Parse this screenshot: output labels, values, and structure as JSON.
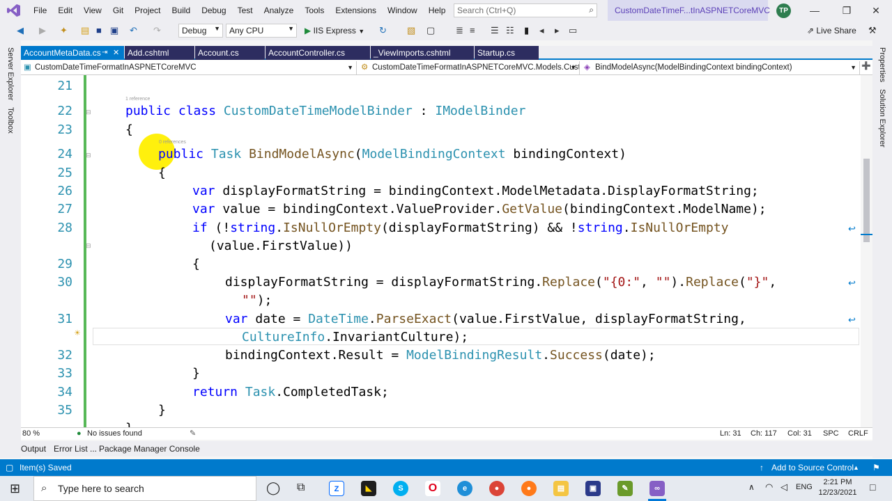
{
  "menubar": {
    "items": [
      "File",
      "Edit",
      "View",
      "Git",
      "Project",
      "Build",
      "Debug",
      "Test",
      "Analyze",
      "Tools",
      "Extensions",
      "Window",
      "Help"
    ],
    "search_placeholder": "Search (Ctrl+Q)",
    "solution_title": "CustomDateTimeF...tInASPNETCoreMVC",
    "avatar_initials": "TP"
  },
  "toolbar": {
    "config": "Debug",
    "platform": "Any CPU",
    "run_label": "IIS Express",
    "live_share": "Live Share"
  },
  "sidebar_left": [
    "Server Explorer",
    "Toolbox"
  ],
  "sidebar_right": [
    "Properties",
    "Solution Explorer"
  ],
  "tabs": [
    {
      "label": "AccountMetaData.cs"
    },
    {
      "label": "Add.cshtml"
    },
    {
      "label": "Account.cs"
    },
    {
      "label": "AccountController.cs"
    },
    {
      "label": "_ViewImports.cshtml"
    },
    {
      "label": "Startup.cs"
    }
  ],
  "navbar": {
    "project": "CustomDateTimeFormatInASPNETCoreMVC",
    "class": "CustomDateTimeFormatInASPNETCoreMVC.Models.Custo",
    "member": "BindModelAsync(ModelBindingContext bindingContext)"
  },
  "code": {
    "line_numbers": [
      "21",
      "22",
      "23",
      "24",
      "25",
      "26",
      "27",
      "28",
      "29",
      "30",
      "31",
      "32",
      "33",
      "34",
      "35"
    ],
    "ref_class": "1 reference",
    "ref_method": "0 references"
  },
  "editor_status": {
    "zoom": "80 %",
    "issues": "No issues found",
    "ln": "Ln: 31",
    "ch": "Ch: 117",
    "col": "Col: 31",
    "spc": "SPC",
    "crlf": "CRLF"
  },
  "bottom_tabs": [
    "Output",
    "Error List ...",
    "Package Manager Console"
  ],
  "statusbar": {
    "message": "Item(s) Saved",
    "source_control": "Add to Source Control"
  },
  "taskbar": {
    "search_placeholder": "Type here to search",
    "lang": "ENG",
    "time": "2:21 PM",
    "date": "12/23/2021"
  }
}
